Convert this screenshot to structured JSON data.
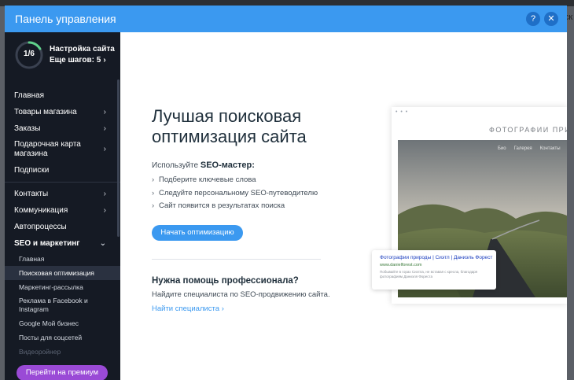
{
  "modal": {
    "title": "Панель управления",
    "help_label": "?",
    "close_label": "✕"
  },
  "backdrop": {
    "right_text": "ск"
  },
  "setup": {
    "progress_text": "1/6",
    "progress_fraction": 0.1667,
    "title": "Настройка сайта",
    "steps_left": "Еще шагов: 5",
    "chevron": "›"
  },
  "sidebar": {
    "items": [
      {
        "label": "Главная",
        "arrow": ""
      },
      {
        "label": "Товары магазина",
        "arrow": "›"
      },
      {
        "label": "Заказы",
        "arrow": "›"
      },
      {
        "label": "Подарочная карта магазина",
        "arrow": "›"
      },
      {
        "label": "Подписки",
        "arrow": ""
      },
      {
        "label": "Контакты",
        "arrow": "›"
      },
      {
        "label": "Коммуникация",
        "arrow": "›"
      },
      {
        "label": "Автопроцессы",
        "arrow": ""
      },
      {
        "label": "SEO и маркетинг",
        "arrow": "⌄"
      }
    ],
    "sub_items": [
      "Главная",
      "Поисковая оптимизация",
      "Маркетинг-рассылка",
      "Реклама в Facebook и Instagram",
      "Google Мой бизнес",
      "Посты для соцсетей",
      "Видеоройнер"
    ],
    "premium_button": "Перейти на премиум"
  },
  "main": {
    "headline": "Лучшая поисковая оптимизация сайта",
    "intro_prefix": "Используйте ",
    "intro_bold": "SEO-мастер:",
    "bullets": [
      "Подберите ключевые слова",
      "Следуйте персональному SEO-путеводителю",
      "Сайт появится в результатах поиска"
    ],
    "bullet_chevron": "›",
    "cta": "Начать оптимизацию",
    "help_title": "Нужна помощь профессионала?",
    "help_text": "Найдите специалиста по SEO-продвижению сайта.",
    "help_link": "Найти специалиста ›"
  },
  "illustration": {
    "dots": "• • •",
    "site_name": "ФОТОГРАФИИ ПРИРОДЫ",
    "nav": [
      "Био",
      "Галерея",
      "Контакты"
    ],
    "serp_title": "Фотографии природы | Сиэтл | Даниэль Форест",
    "serp_url": "www.danielforest.com",
    "serp_desc": "Побывайте в горах Сиэтла, не вставая с кресла, благодаря фотографиям Даниэля Фореста"
  },
  "colors": {
    "header_blue": "#3b99f0",
    "sidebar_bg": "#151a24",
    "premium_purple": "#9a4ad6",
    "progress_green": "#5fd18a"
  }
}
